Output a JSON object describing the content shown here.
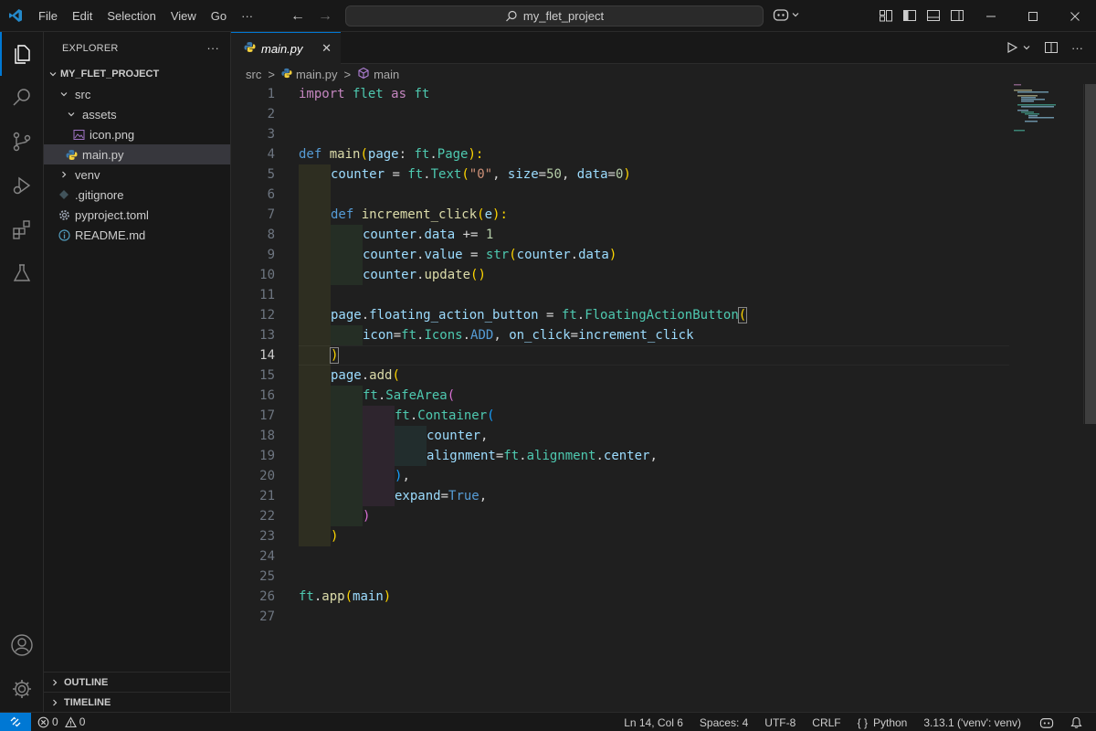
{
  "menu": [
    "File",
    "Edit",
    "Selection",
    "View",
    "Go"
  ],
  "menu_more": "···",
  "search": {
    "text": "my_flet_project"
  },
  "sidebar": {
    "title": "EXPLORER",
    "more": "···",
    "tree": [
      {
        "label": "MY_FLET_PROJECT",
        "kind": "root"
      },
      {
        "label": "src",
        "kind": "folder-open"
      },
      {
        "label": "assets",
        "kind": "folder-open"
      },
      {
        "label": "icon.png",
        "kind": "image"
      },
      {
        "label": "main.py",
        "kind": "python",
        "selected": true
      },
      {
        "label": "venv",
        "kind": "folder-closed"
      },
      {
        "label": ".gitignore",
        "kind": "git"
      },
      {
        "label": "pyproject.toml",
        "kind": "gear"
      },
      {
        "label": "README.md",
        "kind": "info"
      }
    ],
    "outline": "OUTLINE",
    "timeline": "TIMELINE"
  },
  "tab": {
    "label": "main.py",
    "close": "✕"
  },
  "breadcrumb": {
    "folder": "src",
    "file": "main.py",
    "symbol": "main",
    "sep": ">"
  },
  "editor": {
    "current_line": 14,
    "line_numbers": [
      "1",
      "2",
      "3",
      "4",
      "5",
      "6",
      "7",
      "8",
      "9",
      "10",
      "11",
      "12",
      "13",
      "14",
      "15",
      "16",
      "17",
      "18",
      "19",
      "20",
      "21",
      "22",
      "23",
      "24",
      "25",
      "26",
      "27"
    ]
  },
  "code": {
    "l1": [
      "import",
      " flet ",
      "as",
      " ft"
    ],
    "l4": [
      "def",
      " ",
      "main",
      "(",
      "page",
      ": ",
      "ft",
      ".",
      "Page",
      "):"
    ],
    "l5": [
      "counter",
      " = ",
      "ft",
      ".",
      "Text",
      "(",
      "\"0\"",
      ", ",
      "size",
      "=",
      "50",
      ", ",
      "data",
      "=",
      "0",
      ")"
    ],
    "l7": [
      "def",
      " ",
      "increment_click",
      "(",
      "e",
      "):"
    ],
    "l8": [
      "counter",
      ".",
      "data",
      " += ",
      "1"
    ],
    "l9": [
      "counter",
      ".",
      "value",
      " = ",
      "str",
      "(",
      "counter",
      ".",
      "data",
      ")"
    ],
    "l10": [
      "counter",
      ".",
      "update",
      "()"
    ],
    "l12": [
      "page",
      ".",
      "floating_action_button",
      " = ",
      "ft",
      ".",
      "FloatingActionButton",
      "("
    ],
    "l13": [
      "icon",
      "=",
      "ft",
      ".",
      "Icons",
      ".",
      "ADD",
      ", ",
      "on_click",
      "=",
      "increment_click"
    ],
    "l14": [
      ")"
    ],
    "l15": [
      "page",
      ".",
      "add",
      "("
    ],
    "l16": [
      "ft",
      ".",
      "SafeArea",
      "("
    ],
    "l17": [
      "ft",
      ".",
      "Container",
      "("
    ],
    "l18": [
      "counter",
      ","
    ],
    "l19": [
      "alignment",
      "=",
      "ft",
      ".",
      "alignment",
      ".",
      "center",
      ","
    ],
    "l20": [
      ")",
      ","
    ],
    "l21": [
      "expand",
      "=",
      "True",
      ","
    ],
    "l22": [
      ")"
    ],
    "l23": [
      ")"
    ],
    "l26": [
      "ft",
      ".",
      "app",
      "(",
      "main",
      ")"
    ]
  },
  "status": {
    "errors": "0",
    "warnings": "0",
    "position": "Ln 14, Col 6",
    "spaces": "Spaces: 4",
    "encoding": "UTF-8",
    "eol": "CRLF",
    "language": "Python",
    "interpreter": "3.13.1 ('venv': venv)",
    "language_icon": "{ }"
  }
}
